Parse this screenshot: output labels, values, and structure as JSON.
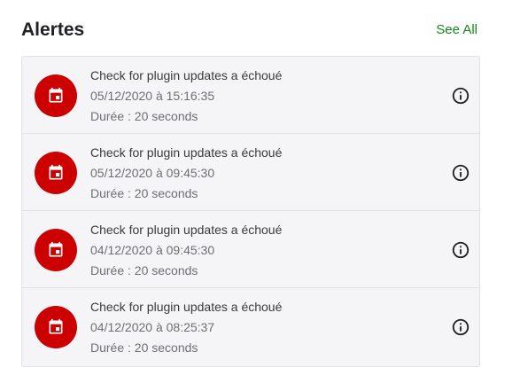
{
  "header": {
    "title": "Alertes",
    "see_all": "See All"
  },
  "colors": {
    "accent_green": "#12891c",
    "avatar_red": "#cc0000"
  },
  "alerts": [
    {
      "icon": "calendar-icon",
      "message": "Check for plugin updates a échoué",
      "datetime": "05/12/2020 à 15:16:35",
      "duration": "Durée : 20 seconds"
    },
    {
      "icon": "calendar-icon",
      "message": "Check for plugin updates a échoué",
      "datetime": "05/12/2020 à 09:45:30",
      "duration": "Durée : 20 seconds"
    },
    {
      "icon": "calendar-icon",
      "message": "Check for plugin updates a échoué",
      "datetime": "04/12/2020 à 09:45:30",
      "duration": "Durée : 20 seconds"
    },
    {
      "icon": "calendar-icon",
      "message": "Check for plugin updates a échoué",
      "datetime": "04/12/2020 à 08:25:37",
      "duration": "Durée : 20 seconds"
    }
  ]
}
